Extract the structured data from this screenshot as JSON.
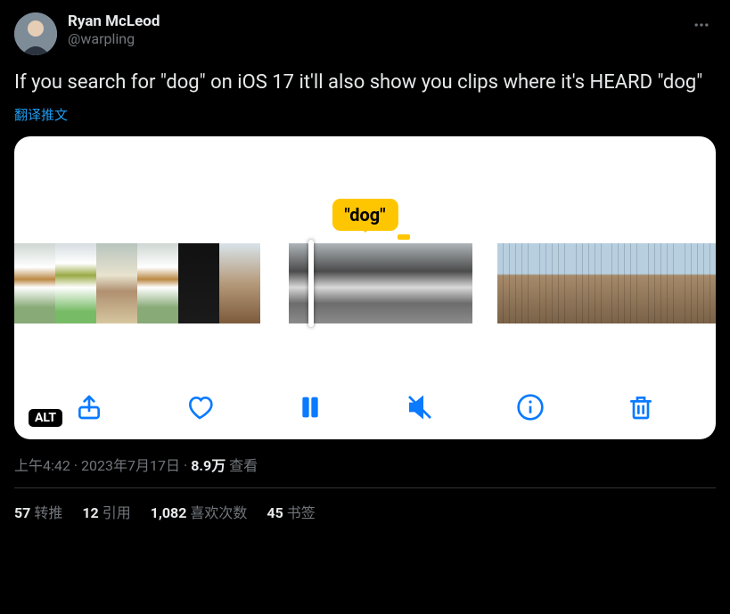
{
  "author": {
    "display_name": "Ryan McLeod",
    "handle": "@warpling"
  },
  "tweet_text": "If you search for \"dog\" on iOS 17 it'll also show you clips where it's HEARD \"dog\"",
  "translate_label": "翻译推文",
  "media": {
    "tooltip_label": "\"dog\"",
    "alt_badge": "ALT",
    "toolbar": {
      "share": "share-icon",
      "like": "heart-icon",
      "pause": "pause-icon",
      "mute": "mute-icon",
      "info": "info-icon",
      "delete": "trash-icon"
    }
  },
  "meta": {
    "time": "上午4:42",
    "date": "2023年7月17日",
    "views_count": "8.9万",
    "views_label": "查看"
  },
  "stats": {
    "retweets_count": "57",
    "retweets_label": "转推",
    "quotes_count": "12",
    "quotes_label": "引用",
    "likes_count": "1,082",
    "likes_label": "喜欢次数",
    "bookmarks_count": "45",
    "bookmarks_label": "书签"
  }
}
